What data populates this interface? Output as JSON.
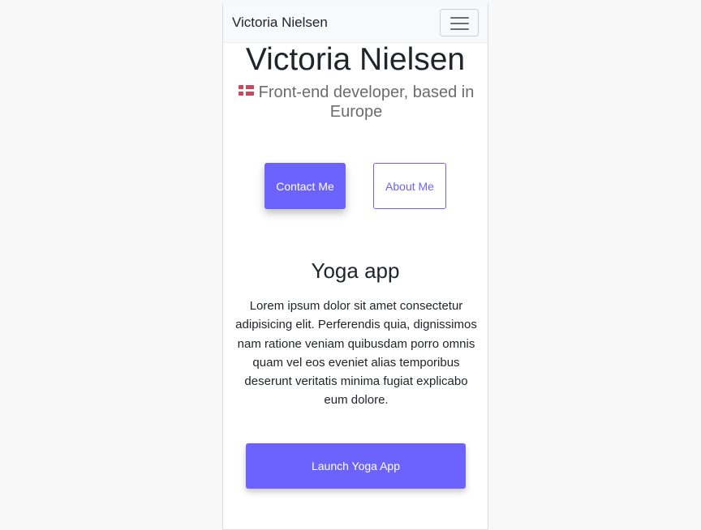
{
  "navbar": {
    "brand": "Victoria Nielsen",
    "toggler_icon": "hamburger-menu-icon"
  },
  "hero": {
    "title": "Victoria Nielsen",
    "flag_icon": "denmark-flag-icon",
    "subtitle": "Front-end developer, based in Europe"
  },
  "actions": {
    "contact_label": "Contact Me",
    "about_label": "About Me"
  },
  "project": {
    "title": "Yoga app",
    "description": "Lorem ipsum dolor sit amet consectetur adipisicing elit. Perferendis quia, dignissimos nam ratione veniam quibusdam porro omnis quam vel eos eveniet alias temporibus deserunt veritatis minima fugiat explicabo eum dolore.",
    "launch_label": "Launch Yoga App"
  },
  "colors": {
    "accent": "#6c63ff",
    "page_background": "#f8f8f8",
    "navbar_background": "#f8f9fa",
    "text_primary": "#212529",
    "text_muted": "#6c6c6c"
  }
}
